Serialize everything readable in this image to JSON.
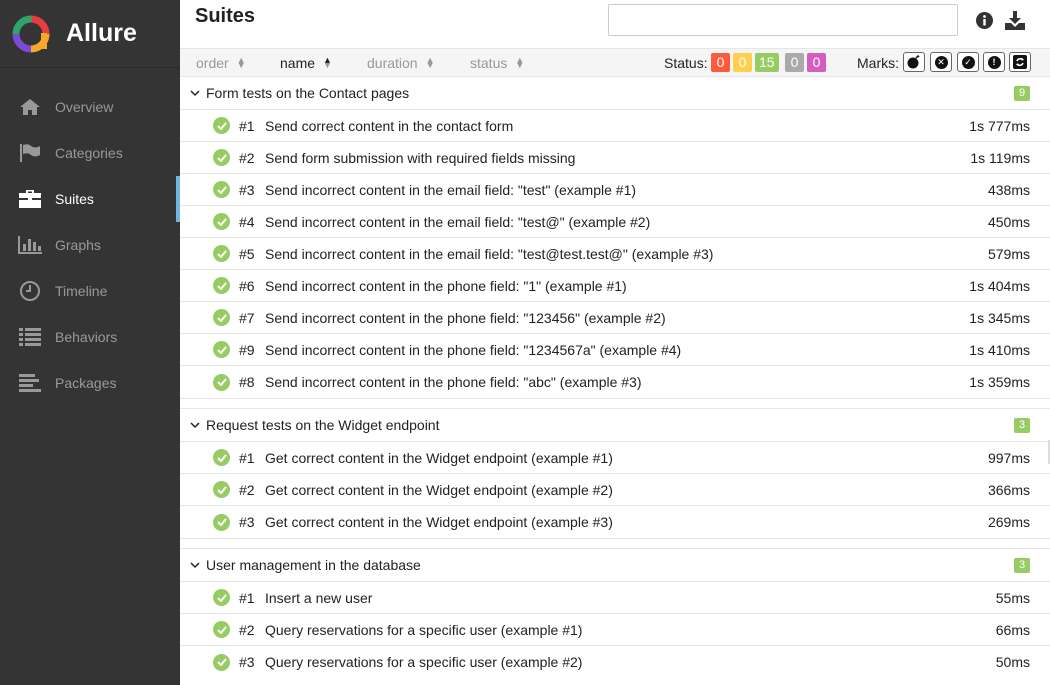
{
  "app": {
    "name": "Allure"
  },
  "nav": [
    {
      "label": "Overview",
      "icon": "home-icon"
    },
    {
      "label": "Categories",
      "icon": "flag-icon"
    },
    {
      "label": "Suites",
      "icon": "briefcase-icon",
      "active": true
    },
    {
      "label": "Graphs",
      "icon": "bar-chart-icon"
    },
    {
      "label": "Timeline",
      "icon": "clock-icon"
    },
    {
      "label": "Behaviors",
      "icon": "list-icon"
    },
    {
      "label": "Packages",
      "icon": "align-left-icon"
    }
  ],
  "header": {
    "title": "Suites",
    "search_value": "",
    "search_placeholder": ""
  },
  "toolbar": {
    "sort": {
      "order": "order",
      "name": "name",
      "duration": "duration",
      "status": "status"
    },
    "status_label": "Status:",
    "status_counts": [
      {
        "name": "failed",
        "value": "0",
        "color": "#fd5a3e"
      },
      {
        "name": "broken",
        "value": "0",
        "color": "#ffd050"
      },
      {
        "name": "passed",
        "value": "15",
        "color": "#97cc64"
      },
      {
        "name": "skipped",
        "value": "0",
        "color": "#aaaaaa"
      },
      {
        "name": "unknown",
        "value": "0",
        "color": "#d35ebe"
      }
    ],
    "marks_label": "Marks:"
  },
  "groups": [
    {
      "title": "Form tests on the Contact pages",
      "count": "9",
      "tests": [
        {
          "order": "#1",
          "name": "Send correct content in the contact form",
          "duration": "1s 777ms"
        },
        {
          "order": "#2",
          "name": "Send form submission with required fields missing",
          "duration": "1s 119ms"
        },
        {
          "order": "#3",
          "name": "Send incorrect content in the email field: \"test\" (example #1)",
          "duration": "438ms"
        },
        {
          "order": "#4",
          "name": "Send incorrect content in the email field: \"test@\" (example #2)",
          "duration": "450ms"
        },
        {
          "order": "#5",
          "name": "Send incorrect content in the email field: \"test@test.test@\" (example #3)",
          "duration": "579ms"
        },
        {
          "order": "#6",
          "name": "Send incorrect content in the phone field: \"1\" (example #1)",
          "duration": "1s 404ms"
        },
        {
          "order": "#7",
          "name": "Send incorrect content in the phone field: \"123456\" (example #2)",
          "duration": "1s 345ms"
        },
        {
          "order": "#9",
          "name": "Send incorrect content in the phone field: \"1234567a\" (example #4)",
          "duration": "1s 410ms"
        },
        {
          "order": "#8",
          "name": "Send incorrect content in the phone field: \"abc\" (example #3)",
          "duration": "1s 359ms"
        }
      ]
    },
    {
      "title": "Request tests on the Widget endpoint",
      "count": "3",
      "tests": [
        {
          "order": "#1",
          "name": "Get correct content in the Widget endpoint (example #1)",
          "duration": "997ms"
        },
        {
          "order": "#2",
          "name": "Get correct content in the Widget endpoint (example #2)",
          "duration": "366ms"
        },
        {
          "order": "#3",
          "name": "Get correct content in the Widget endpoint (example #3)",
          "duration": "269ms"
        }
      ]
    },
    {
      "title": "User management in the database",
      "count": "3",
      "tests": [
        {
          "order": "#1",
          "name": "Insert a new user",
          "duration": "55ms"
        },
        {
          "order": "#2",
          "name": "Query reservations for a specific user (example #1)",
          "duration": "66ms"
        },
        {
          "order": "#3",
          "name": "Query reservations for a specific user (example #2)",
          "duration": "50ms"
        }
      ]
    }
  ]
}
